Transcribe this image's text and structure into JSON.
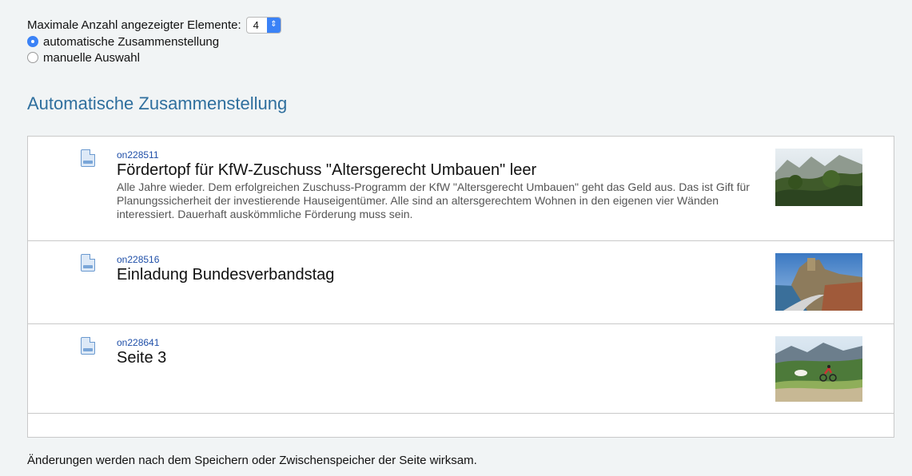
{
  "settings": {
    "max_label": "Maximale Anzahl angezeigter Elemente:",
    "max_value": "4",
    "radio_auto": "automatische Zusammenstellung",
    "radio_manual": "manuelle Auswahl"
  },
  "section_title": "Automatische Zusammenstellung",
  "items": [
    {
      "id": "on228511",
      "title": "Fördertopf für KfW-Zuschuss \"Altersgerecht Umbauen\" leer",
      "description": "Alle Jahre wieder. Dem erfolgreichen Zuschuss-Programm der KfW \"Altersgerecht Umbauen\" geht das Geld aus. Das ist Gift für Planungssicherheit der investierende Hauseigentümer. Alle sind an altersgerechtem Wohnen in den eigenen vier Wänden interessiert. Dauerhaft auskömmliche Förderung muss sein."
    },
    {
      "id": "on228516",
      "title": "Einladung Bundesverbandstag",
      "description": ""
    },
    {
      "id": "on228641",
      "title": "Seite 3",
      "description": ""
    }
  ],
  "footer_text": "Änderungen werden nach dem Speichern oder Zwischenspeicher der Seite wirksam.",
  "colors": {
    "accent": "#3b82f6",
    "heading": "#2f6f9e",
    "link": "#1f4fa8"
  }
}
